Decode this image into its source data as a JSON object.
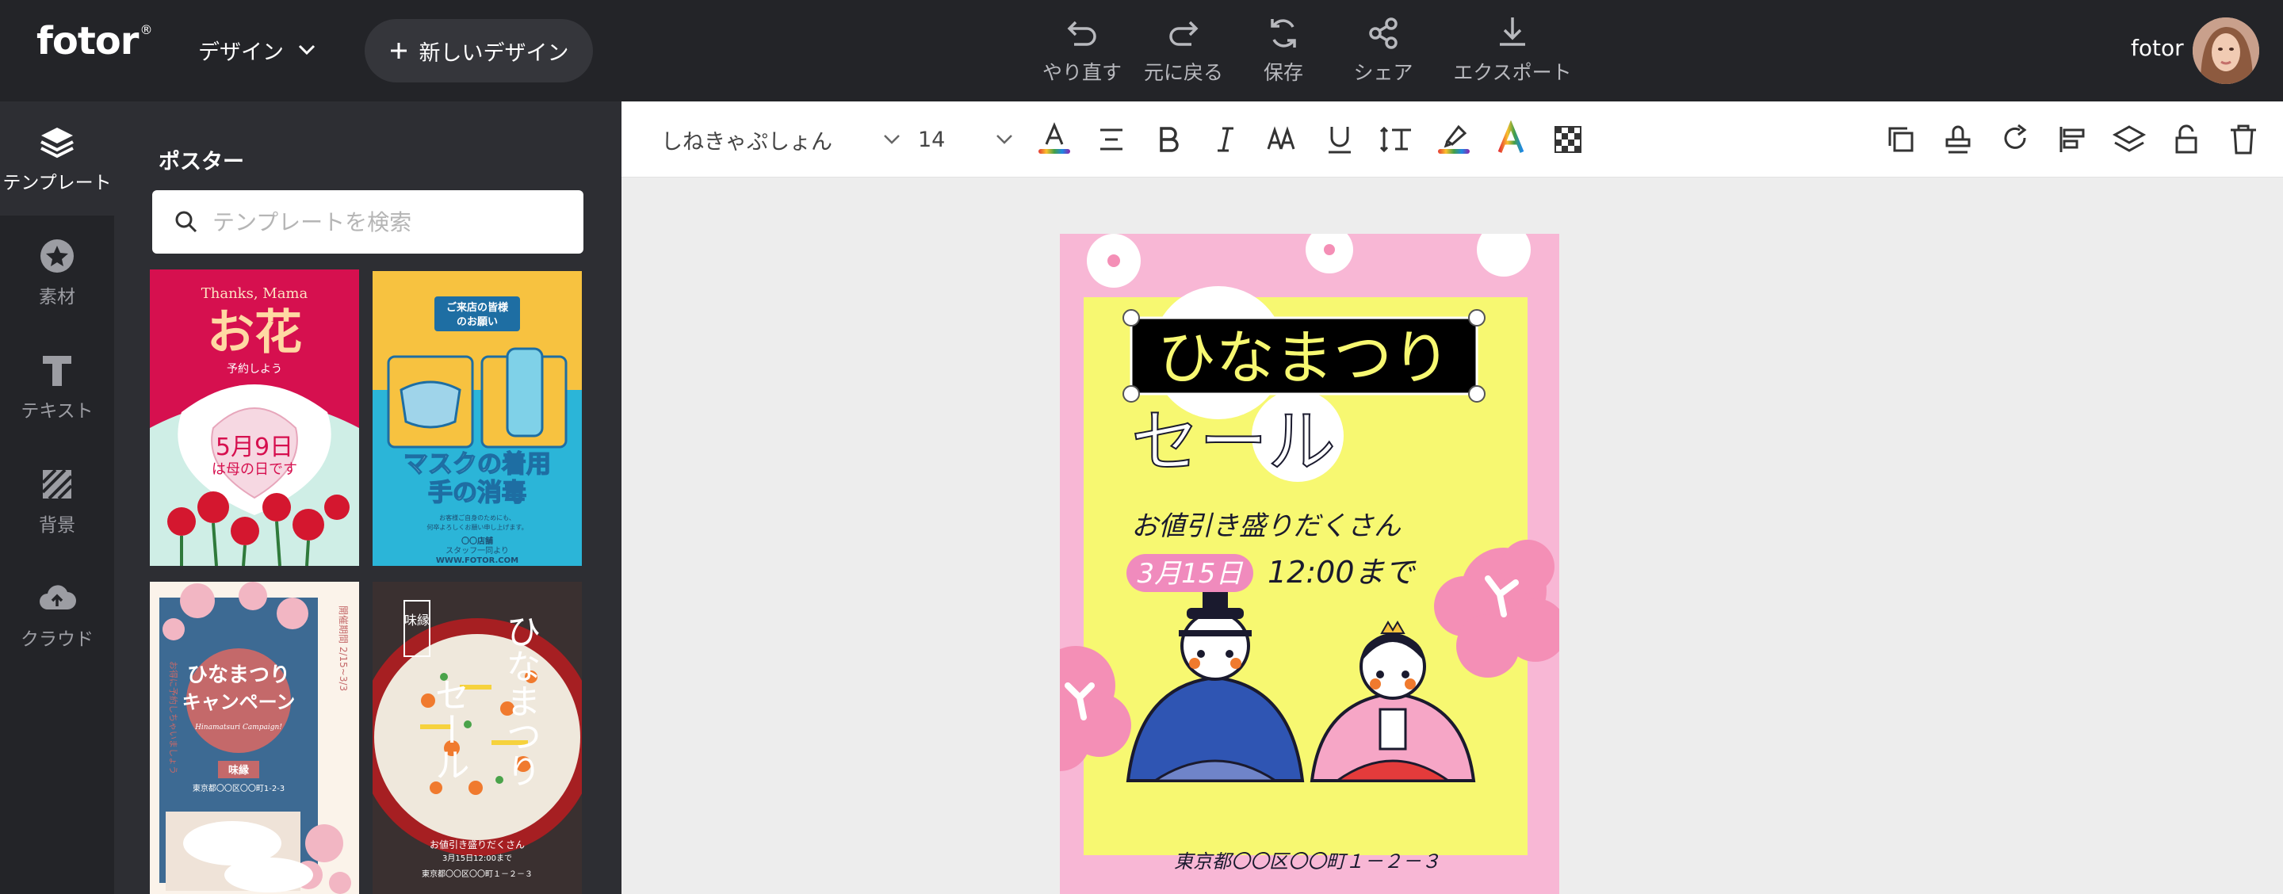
{
  "header": {
    "logo": "fotor",
    "logo_mark": "®",
    "design_menu": "デザイン",
    "new_design": "新しいデザイン",
    "tools": [
      {
        "label": "やり直す",
        "icon": "undo-icon"
      },
      {
        "label": "元に戻る",
        "icon": "redo-icon"
      },
      {
        "label": "保存",
        "icon": "save-icon"
      },
      {
        "label": "シェア",
        "icon": "share-icon"
      },
      {
        "label": "エクスポート",
        "icon": "export-icon"
      }
    ],
    "user_name": "fotor"
  },
  "leftnav": {
    "items": [
      {
        "label": "テンプレート",
        "icon": "layers-icon",
        "active": true
      },
      {
        "label": "素材",
        "icon": "star-icon"
      },
      {
        "label": "テキスト",
        "icon": "text-icon"
      },
      {
        "label": "背景",
        "icon": "background-icon"
      },
      {
        "label": "クラウド",
        "icon": "cloud-upload-icon"
      }
    ]
  },
  "panel": {
    "title": "ポスター",
    "search_placeholder": "テンプレートを検索",
    "templates": [
      {
        "name": "mothers-day",
        "texts": [
          "Thanks, Mama",
          "お花",
          "予約しよう",
          "5月9日",
          "は母の日です"
        ]
      },
      {
        "name": "mask-notice",
        "texts": [
          "ご来店の皆様",
          "のお願い",
          "マスクの着用",
          "手の消毒",
          "お客様ご自身のためにも、",
          "何卒よろしくお願い申し上げます。",
          "〇〇店舗",
          "スタッフ一同より",
          "WWW.FOTOR.COM"
        ]
      },
      {
        "name": "hinamatsuri-campaign",
        "texts": [
          "ひなまつり",
          "キャンペーン",
          "Hinamatsuri Campaign!",
          "開催期間 2/15~3/3",
          "お得に予約しちゃいましょう",
          "味縁",
          "東京都〇〇区〇〇町1-2-3"
        ]
      },
      {
        "name": "hinamatsuri-sale-food",
        "texts": [
          "ひなまつり",
          "セール",
          "味縁",
          "お値引き盛りだくさん",
          "3月15日12:00まで",
          "東京都〇〇区〇〇町１－２－３"
        ]
      }
    ]
  },
  "toolbar": {
    "font": "しねきゃぷしょん",
    "size": "14",
    "colors": {
      "text_color_bar": "#e53935",
      "highlight": "#f5d400"
    }
  },
  "poster": {
    "title": "ひなまつり",
    "subtitle": "セール",
    "tagline": "お値引き盛りだくさん",
    "date": "3月15日",
    "time": "12:00まで",
    "address": "東京都〇〇区〇〇町１－２－３",
    "colors": {
      "pink": "#f8b7d5",
      "yellow": "#f7f871",
      "title_fill": "#f7f871",
      "date_fill": "#f08bbd"
    }
  }
}
